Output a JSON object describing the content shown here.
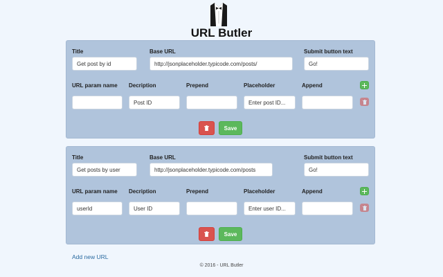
{
  "app": {
    "title": "URL Butler",
    "logo_icon": "butler-tuxedo-icon"
  },
  "labels": {
    "title": "Title",
    "base_url": "Base URL",
    "submit_text": "Submit button text",
    "param_name": "URL param name",
    "description": "Decription",
    "prepend": "Prepend",
    "placeholder": "Placeholder",
    "append": "Append"
  },
  "buttons": {
    "save": "Save",
    "add_icon": "plus-icon",
    "delete_icon": "trash-icon"
  },
  "urls": [
    {
      "title": "Get post by id",
      "base_url": "http://jsonplaceholder.typicode.com/posts/",
      "submit_text": "Go!",
      "param": {
        "name": "",
        "description": "Post ID",
        "prepend": "",
        "placeholder": "Enter post ID...",
        "append": ""
      }
    },
    {
      "title": "Get posts by user",
      "base_url": "http://jsonplaceholder.typicode.com/posts",
      "submit_text": "Go!",
      "param": {
        "name": "userId",
        "description": "User ID",
        "prepend": "",
        "placeholder": "Enter user ID...",
        "append": ""
      }
    }
  ],
  "add_new_url": "Add new URL",
  "footer": "© 2016 - URL Butler",
  "colors": {
    "background": "#f0f6fd",
    "panel": "#b0c4dc",
    "success": "#5cb85c",
    "danger": "#d9534f",
    "link": "#2a6aa0"
  }
}
